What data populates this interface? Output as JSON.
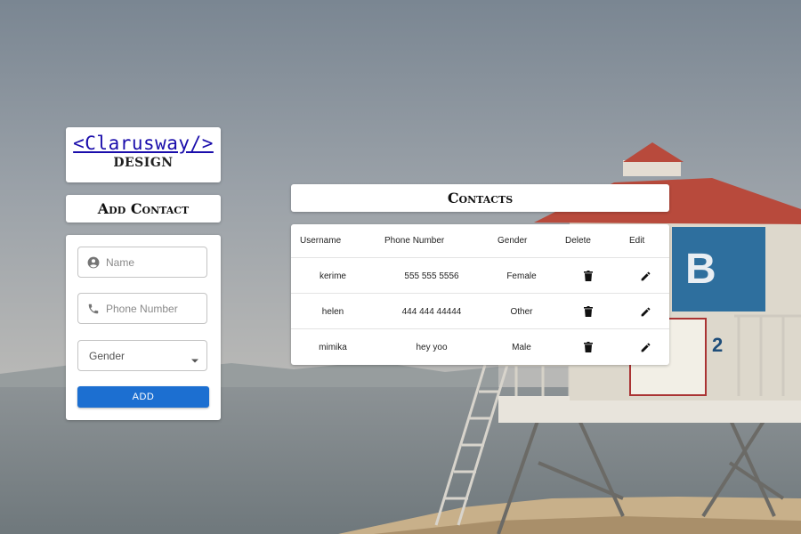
{
  "brand": {
    "logo_text": "<Clarusway/>",
    "subtitle": "DESIGN"
  },
  "add_contact": {
    "title": "Add Contact",
    "name_placeholder": "Name",
    "phone_placeholder": "Phone Number",
    "gender_label": "Gender",
    "add_button": "ADD"
  },
  "contacts": {
    "title": "Contacts",
    "columns": [
      "Username",
      "Phone Number",
      "Gender",
      "Delete",
      "Edit"
    ],
    "rows": [
      {
        "username": "kerime",
        "phone": "555 555 5556",
        "gender": "Female"
      },
      {
        "username": "helen",
        "phone": "444 444 44444",
        "gender": "Other"
      },
      {
        "username": "mimika",
        "phone": "hey yoo",
        "gender": "Male"
      }
    ]
  },
  "colors": {
    "accent": "#1c6fd1",
    "logo_link": "#1a0dab"
  }
}
